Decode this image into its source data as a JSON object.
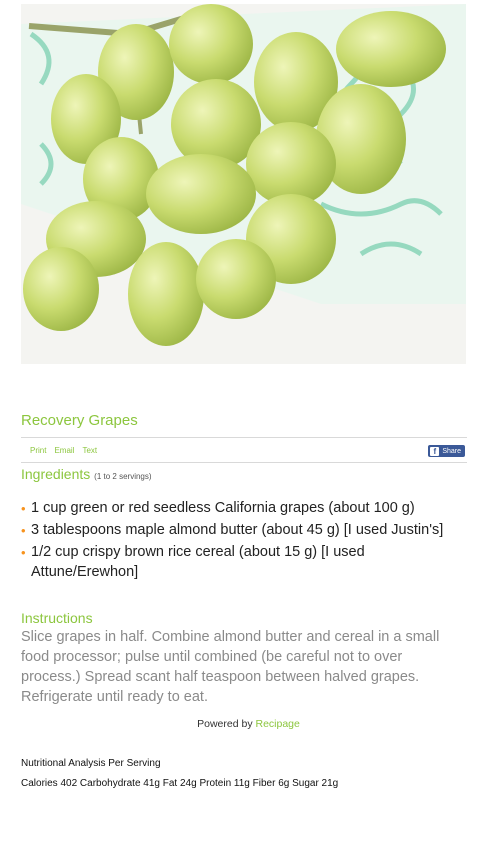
{
  "hero": {
    "alt": "green grapes on a patterned napkin"
  },
  "recipe": {
    "title": "Recovery Grapes"
  },
  "toolbar": {
    "print_label": "Print",
    "email_label": "Email",
    "text_label": "Text",
    "share_label": "Share",
    "share_icon": "facebook-icon"
  },
  "ingredients": {
    "heading": "Ingredients",
    "servings": "(1 to 2 servings)",
    "items": [
      "1 cup green or red seedless California grapes (about 100 g)",
      "3 tablespoons maple almond butter (about 45 g) [I used Justin's]",
      "1/2 cup crispy brown rice cereal (about 15 g) [I used Attune/Erewhon]"
    ]
  },
  "instructions": {
    "heading": "Instructions",
    "text": "Slice grapes in half. Combine almond butter and cereal in a small food processor; pulse until combined (be careful not to over process.) Spread scant half teaspoon between halved grapes. Refrigerate until ready to eat."
  },
  "footer": {
    "powered_prefix": "Powered by",
    "powered_link": "Recipage"
  },
  "nutrition": {
    "title": "Nutritional Analysis Per Serving",
    "values": "Calories 402 Carbohydrate 41g Fat 24g Protein 11g Fiber 6g Sugar 21g"
  },
  "colors": {
    "accent": "#8cc63e",
    "bullet": "#f7931e",
    "facebook": "#3b5998"
  }
}
